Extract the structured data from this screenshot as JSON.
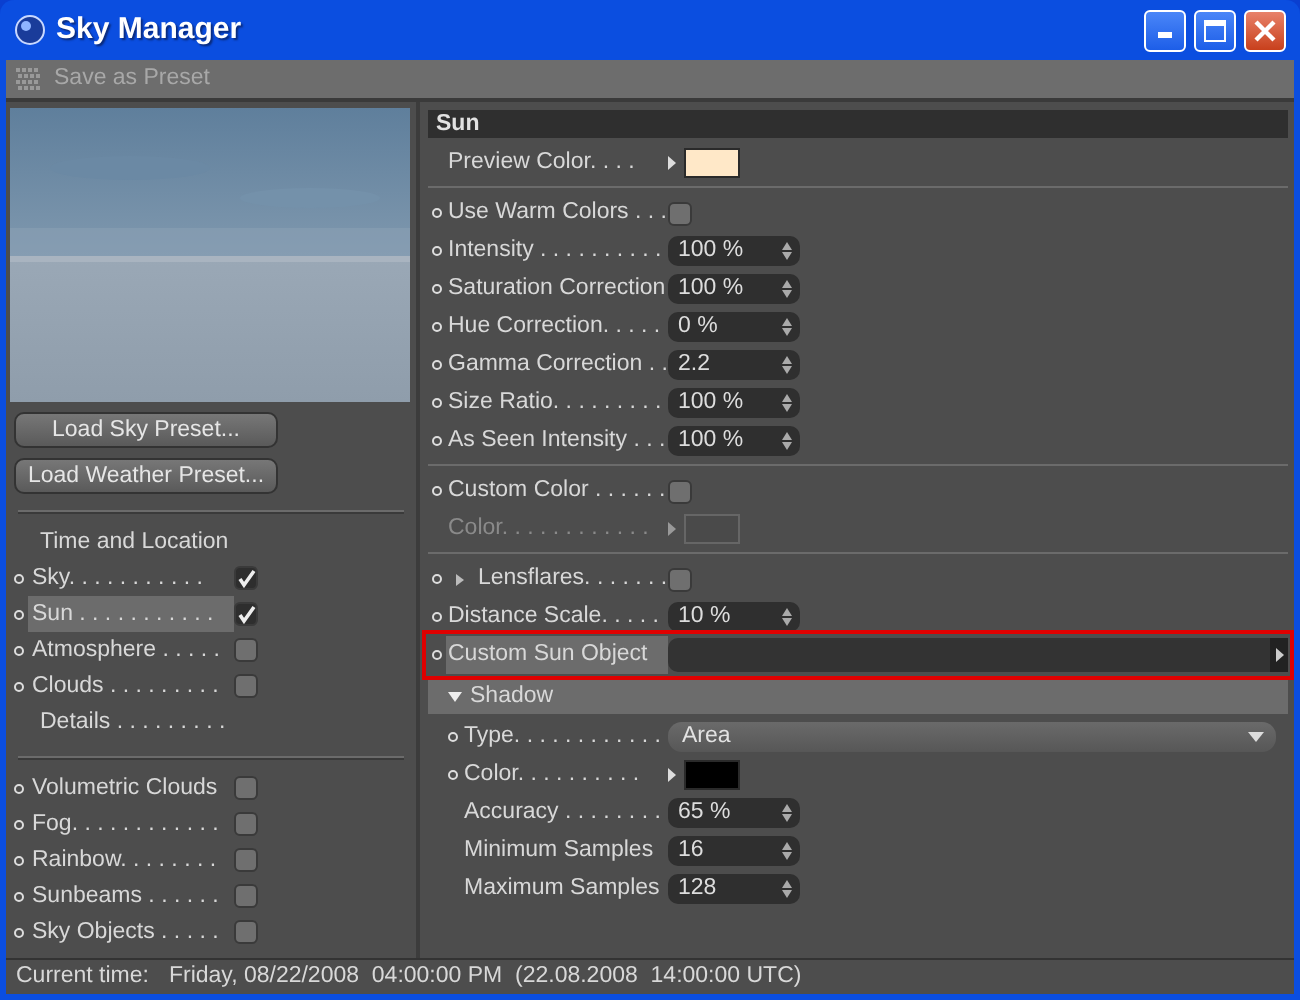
{
  "window": {
    "title": "Sky Manager"
  },
  "toolbar": {
    "label": "Save as Preset",
    "disabled": true
  },
  "preview": {
    "kind": "picture"
  },
  "buttons": [
    "Load Sky Preset...",
    "Load Weather Preset..."
  ],
  "nav_groups": [
    [
      {
        "kind": "heading",
        "label": "Time and Location",
        "dot": false
      },
      {
        "kind": "check",
        "label": "Sky. . . . . . . . . . .",
        "dot": true,
        "checked": true,
        "selected": false
      },
      {
        "kind": "check",
        "label": "Sun . . . . . . . . . . .",
        "dot": true,
        "checked": true,
        "selected": true
      },
      {
        "kind": "check",
        "label": "Atmosphere . . . . .",
        "dot": true,
        "checked": false,
        "selected": false
      },
      {
        "kind": "check",
        "label": "Clouds . . . . . . . . .",
        "dot": true,
        "checked": false,
        "selected": false
      },
      {
        "kind": "heading",
        "label": "Details . . . . . . . . .",
        "dot": false
      }
    ],
    [
      {
        "kind": "check",
        "label": "Volumetric Clouds",
        "dot": true,
        "checked": false,
        "selected": false
      },
      {
        "kind": "check",
        "label": "Fog. . . . . . . . . . . .",
        "dot": true,
        "checked": false,
        "selected": false
      },
      {
        "kind": "check",
        "label": "Rainbow. . . . . . . .",
        "dot": true,
        "checked": false,
        "selected": false
      },
      {
        "kind": "check",
        "label": "Sunbeams . . . . . .",
        "dot": true,
        "checked": false,
        "selected": false
      },
      {
        "kind": "check",
        "label": "Sky Objects . . . . .",
        "dot": true,
        "checked": false,
        "selected": false
      }
    ]
  ],
  "panel": {
    "title": "Sun",
    "sections": [
      [
        {
          "kind": "color",
          "label": "Preview Color. . . .",
          "dot": false,
          "color": "#ffe8c8",
          "disabled": false
        }
      ],
      [
        {
          "kind": "check",
          "label": "Use Warm Colors . . .",
          "dot": true,
          "checked": false
        },
        {
          "kind": "spin",
          "label": "Intensity . . . . . . . . . .",
          "dot": true,
          "value": "100 %"
        },
        {
          "kind": "spin",
          "label": "Saturation Correction",
          "dot": true,
          "value": "100 %"
        },
        {
          "kind": "spin",
          "label": "Hue Correction. . . . .",
          "dot": true,
          "value": "0 %"
        },
        {
          "kind": "spin",
          "label": "Gamma Correction . .",
          "dot": true,
          "value": "2.2"
        },
        {
          "kind": "spin",
          "label": "Size Ratio. . . . . . . . .",
          "dot": true,
          "value": "100 %"
        },
        {
          "kind": "spin",
          "label": "As Seen Intensity . . .",
          "dot": true,
          "value": "100 %"
        }
      ],
      [
        {
          "kind": "check",
          "label": "Custom Color . . . . . .",
          "dot": true,
          "checked": false
        },
        {
          "kind": "color",
          "label": "Color. . . . . . . . . . . .",
          "dot": false,
          "color": "#4a4a4a",
          "disabled": true
        }
      ],
      [
        {
          "kind": "check",
          "label": "Lensflares. . . . . . .",
          "dot": true,
          "checked": false,
          "expanded": false
        },
        {
          "kind": "spin",
          "label": "Distance Scale. . . . .",
          "dot": true,
          "value": "10 %"
        },
        {
          "kind": "link",
          "label": "Custom Sun Object",
          "dot": true,
          "selected": true,
          "outlined": true
        },
        {
          "kind": "group",
          "label": "Shadow",
          "expanded": true,
          "children": [
            {
              "kind": "dropdown",
              "label": "Type. . . . . . . . . . . .",
              "dot": true,
              "value": "Area"
            },
            {
              "kind": "color",
              "label": "Color. . . . . . . . . .",
              "dot": true,
              "color": "#000000",
              "disabled": false
            },
            {
              "kind": "spin",
              "label": "Accuracy . . . . . . . .",
              "dot": false,
              "value": "65 %"
            },
            {
              "kind": "spin",
              "label": "Minimum Samples",
              "dot": false,
              "value": "16"
            },
            {
              "kind": "spin",
              "label": "Maximum Samples",
              "dot": false,
              "value": "128"
            }
          ]
        }
      ]
    ]
  },
  "status_bar": {
    "label": "Current time:",
    "value": "Friday, 08/22/2008  04:00:00 PM  (22.08.2008  14:00:00 UTC)"
  }
}
